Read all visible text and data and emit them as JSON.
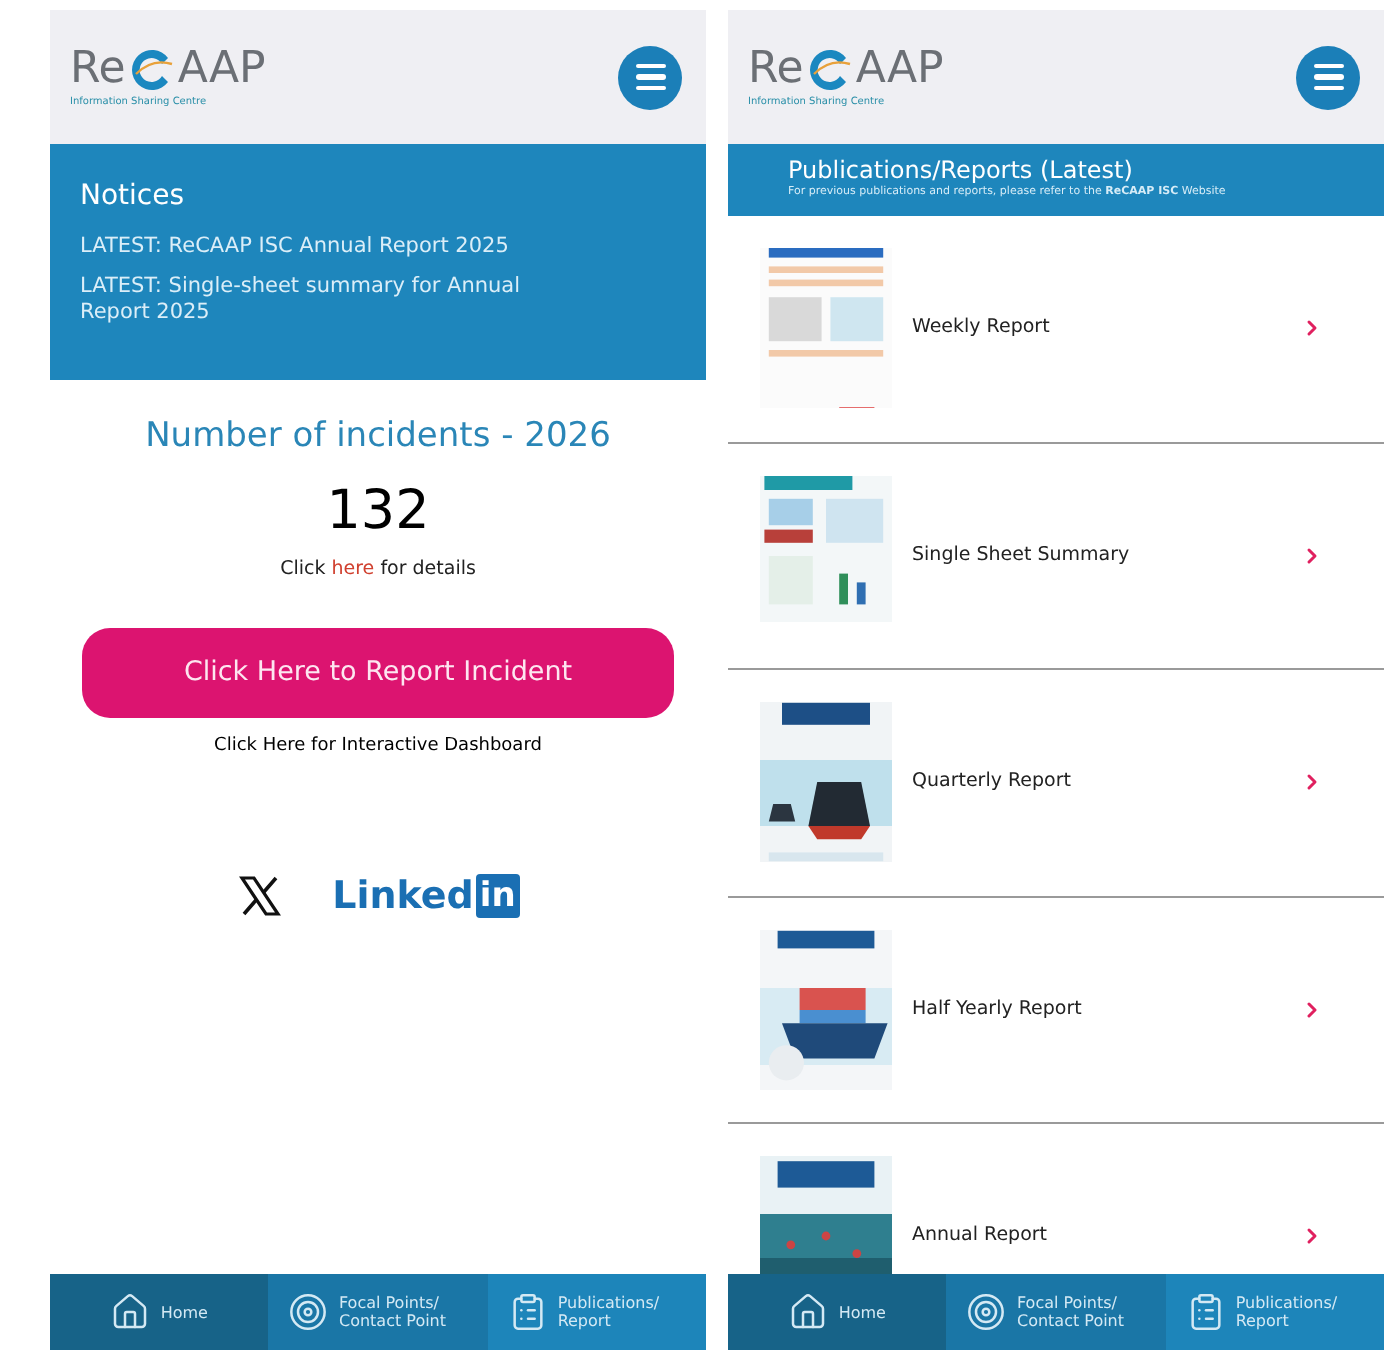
{
  "screens": [
    {
      "header": {
        "logo": {
          "prefix": "Re",
          "suffix": "AAP",
          "tagline": "Information Sharing Centre"
        }
      },
      "notices": {
        "title": "Notices",
        "items": [
          "LATEST: ReCAAP ISC Annual Report 2025",
          "LATEST: Single-sheet summary for Annual Report 2025"
        ]
      },
      "incidents": {
        "title": "Number of incidents - 2026",
        "count": "132",
        "details": {
          "before": "Click",
          "link": "here",
          "after": "for details"
        }
      },
      "report_button": "Click Here to Report Incident",
      "dashboard_link": "Click Here for Interactive Dashboard",
      "social": {
        "linkedin": {
          "word": "Linked",
          "badge": "in"
        }
      },
      "nav": [
        {
          "label": "Home",
          "kind": "home",
          "selected": true
        },
        {
          "label": "Focal Points/ Contact Point",
          "kind": "target",
          "selected": false
        },
        {
          "label": "Publications/ Report",
          "kind": "doc",
          "selected": false
        }
      ]
    },
    {
      "header": {
        "logo": {
          "prefix": "Re",
          "suffix": "AAP",
          "tagline": "Information Sharing Centre"
        }
      },
      "publications": {
        "title": "Publications/Reports (Latest)",
        "subtitle": "For previous publications and reports, please refer to the **ReCAAP ISC** Website",
        "items": [
          {
            "label": "Weekly Report",
            "kind": "document"
          },
          {
            "label": "Single Sheet Summary",
            "kind": "infographic"
          },
          {
            "label": "Quarterly Report",
            "kind": "ship"
          },
          {
            "label": "Half Yearly Report",
            "kind": "cargo"
          },
          {
            "label": "Annual Report",
            "kind": "sea"
          }
        ]
      },
      "nav": [
        {
          "label": "Home",
          "kind": "home",
          "selected": true
        },
        {
          "label": "Focal Points/ Contact Point",
          "kind": "target",
          "selected": false
        },
        {
          "label": "Publications/ Report",
          "kind": "doc",
          "selected": false
        }
      ]
    }
  ]
}
